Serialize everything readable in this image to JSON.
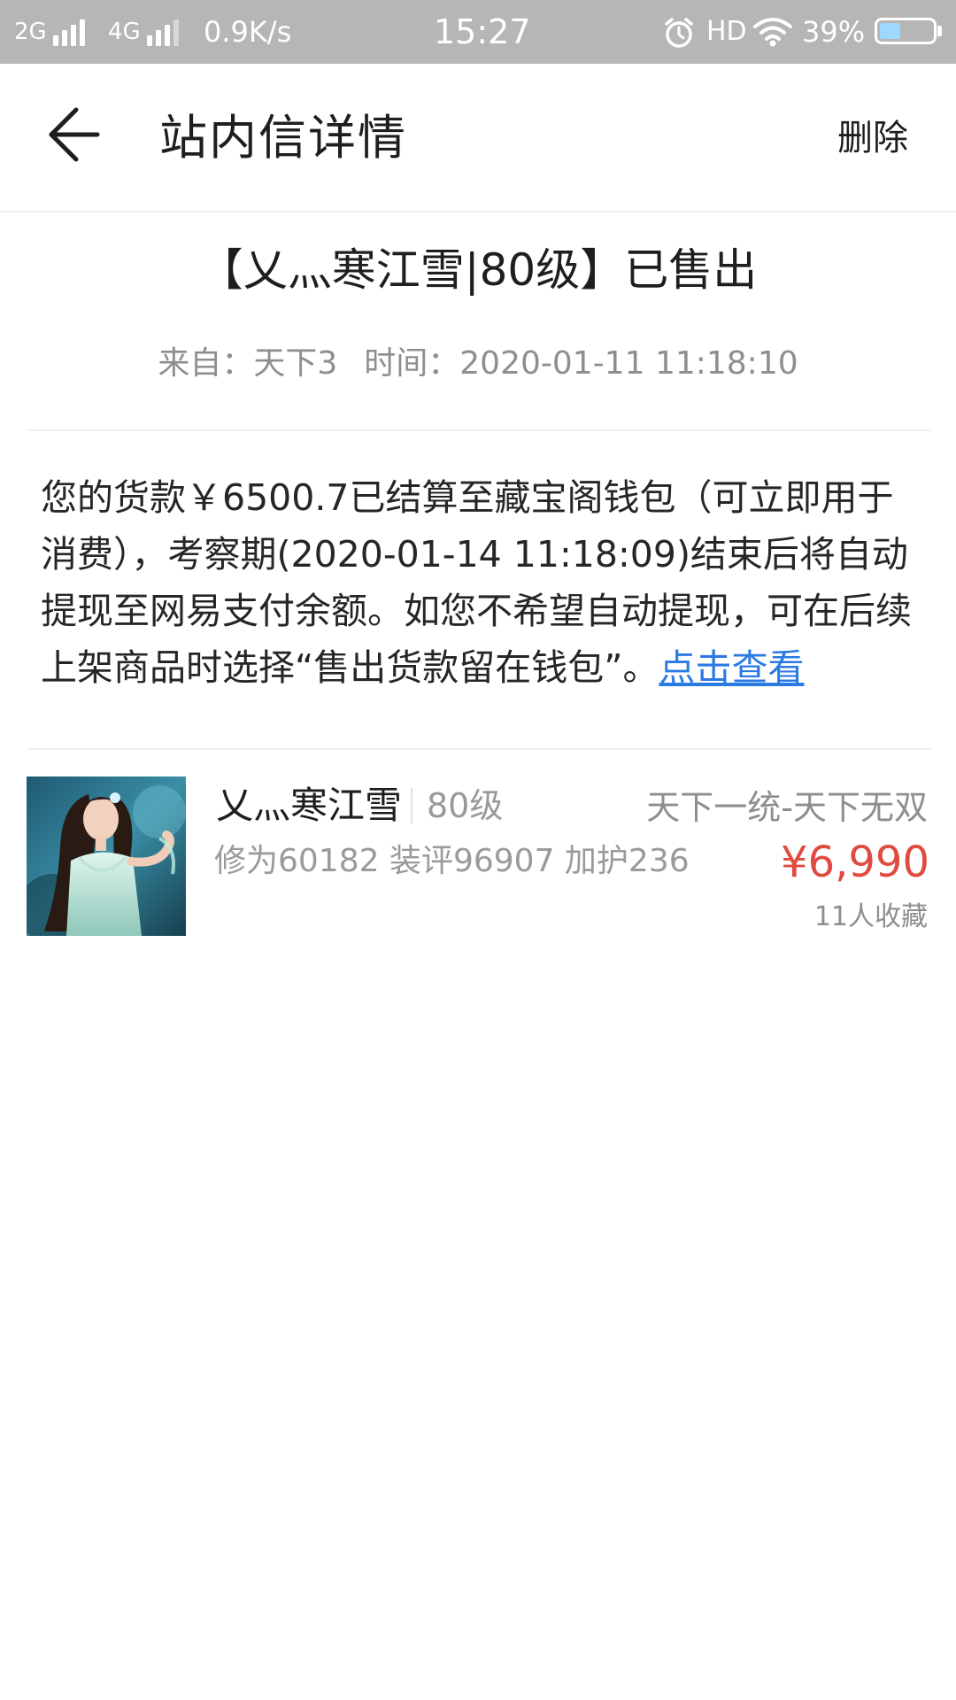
{
  "status_bar": {
    "network_1": "2G",
    "network_2": "4G",
    "speed": "0.9K/s",
    "time": "15:27",
    "hd": "HD",
    "battery_percent": "39%",
    "battery_level": 0.39,
    "alarm_icon": "alarm-icon",
    "wifi_icon": "wifi-icon"
  },
  "header": {
    "back_icon": "arrow-left-icon",
    "title": "站内信详情",
    "delete_label": "删除"
  },
  "message": {
    "title": "【乂灬寒江雪|80级】已售出",
    "from_label": "来自：天下3",
    "time_label": "时间：2020-01-11 11:18:10",
    "body_text": "您的货款￥6500.7已结算至藏宝阁钱包（可立即用于消费），考察期(2020-01-14 11:18:09)结束后将自动提现至网易支付余额。如您不希望自动提现，可在后续上架商品时选择“售出货款留在钱包”。",
    "link_text": "点击查看"
  },
  "item": {
    "name": "乂灬寒江雪",
    "level": "80级",
    "server": "天下一统-天下无双",
    "stats": "修为60182 装评96907 加护236",
    "price": "¥6,990",
    "favorites": "11人收藏"
  },
  "colors": {
    "status_bar_bg": "#b6b6b6",
    "link": "#2a7ae4",
    "price": "#e04a3f",
    "meta_text": "#8e8e8e"
  }
}
